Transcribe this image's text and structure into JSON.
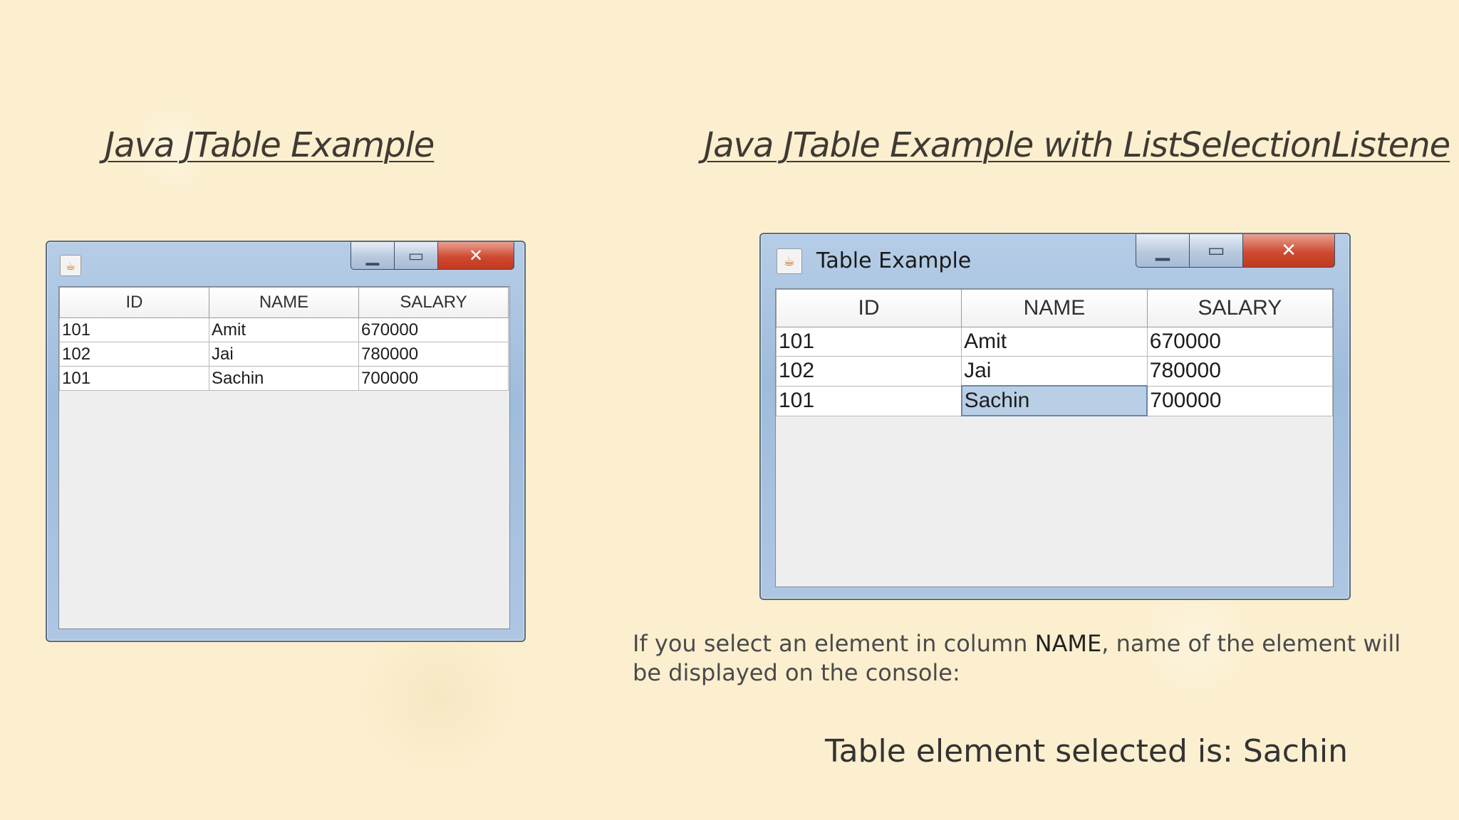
{
  "slide": {
    "title_left": "Java JTable Example",
    "title_right": "Java JTable Example with ListSelectionListene",
    "explanation_before": "If you select an element in column ",
    "explanation_bold": "NAME",
    "explanation_after": ", name of the element will be displayed on the console:",
    "console_output": "Table element selected is: Sachin"
  },
  "window_left": {
    "caption": "",
    "icon": "java-coffee-icon",
    "controls": {
      "min": "minimize-icon",
      "max": "maximize-icon",
      "close": "close-icon"
    },
    "columns": [
      "ID",
      "NAME",
      "SALARY"
    ],
    "rows": [
      [
        "101",
        "Amit",
        "670000"
      ],
      [
        "102",
        "Jai",
        "780000"
      ],
      [
        "101",
        "Sachin",
        "700000"
      ]
    ]
  },
  "window_right": {
    "caption": "Table Example",
    "icon": "java-coffee-icon",
    "controls": {
      "min": "minimize-icon",
      "max": "maximize-icon",
      "close": "close-icon"
    },
    "columns": [
      "ID",
      "NAME",
      "SALARY"
    ],
    "rows": [
      [
        "101",
        "Amit",
        "670000"
      ],
      [
        "102",
        "Jai",
        "780000"
      ],
      [
        "101",
        "Sachin",
        "700000"
      ]
    ],
    "selected_cell": {
      "row": 2,
      "column": "NAME"
    }
  },
  "colors": {
    "background": "#fbefcf",
    "selection": "#b9cfe5",
    "close_button": "#cf4a32"
  }
}
